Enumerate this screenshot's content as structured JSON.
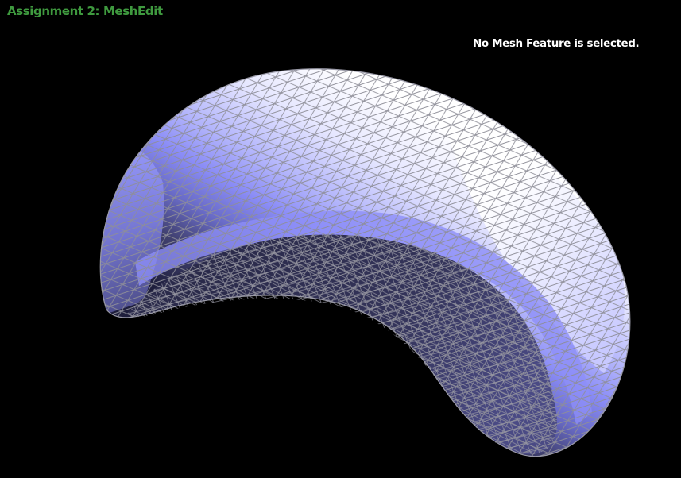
{
  "window": {
    "title": "Assignment 2: MeshEdit"
  },
  "status": {
    "message": "No Mesh Feature is selected."
  },
  "colors": {
    "background": "#000000",
    "title": "#3f9a3f",
    "status_text": "#ffffff",
    "mesh_light": "#ffffff",
    "mesh_mid": "#8a8cf6",
    "mesh_dark": "#1e1e3c",
    "wireframe": "#8e8e98"
  }
}
